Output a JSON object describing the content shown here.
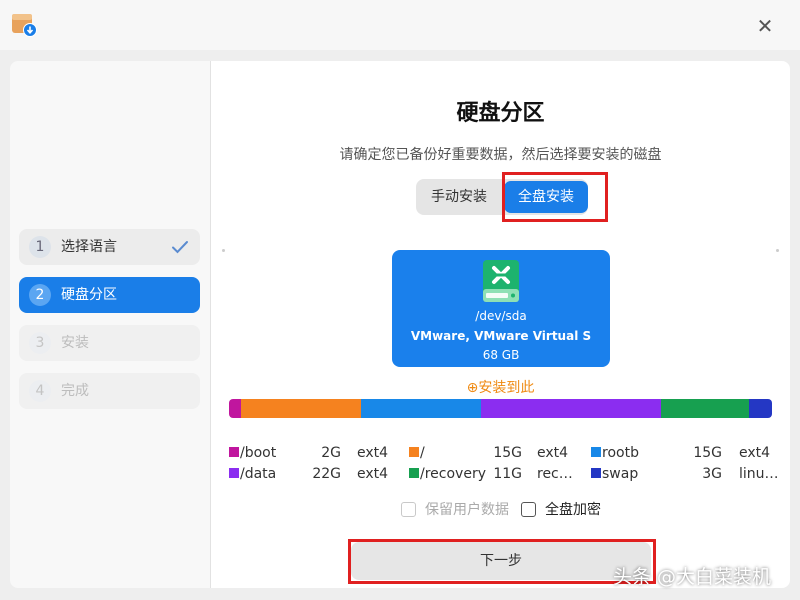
{
  "sidebar": {
    "steps": [
      {
        "num": "1",
        "label": "选择语言",
        "state": "done"
      },
      {
        "num": "2",
        "label": "硬盘分区",
        "state": "active"
      },
      {
        "num": "3",
        "label": "安装",
        "state": "disabled"
      },
      {
        "num": "4",
        "label": "完成",
        "state": "disabled"
      }
    ]
  },
  "main": {
    "title": "硬盘分区",
    "subtitle": "请确定您已备份好重要数据，然后选择要安装的磁盘",
    "mode": {
      "manual_label": "手动安装",
      "full_label": "全盘安装",
      "selected": "全盘安装"
    },
    "disk": {
      "device": "/dev/sda",
      "model": "VMware, VMware Virtual S",
      "size": "68 GB"
    },
    "install_here": "⊕安装到此",
    "partitions": [
      {
        "name": "/boot",
        "size": "2G",
        "fs": "ext4",
        "color": "#c0169e",
        "fraction": 0.022
      },
      {
        "name": "/",
        "size": "15G",
        "fs": "ext4",
        "color": "#f5821f",
        "fraction": 0.221
      },
      {
        "name": "rootb",
        "size": "15G",
        "fs": "ext4",
        "color": "#1888e8",
        "fraction": 0.221
      },
      {
        "name": "/data",
        "size": "22G",
        "fs": "ext4",
        "color": "#8b2df0",
        "fraction": 0.331
      },
      {
        "name": "/recovery",
        "size": "11G",
        "fs": "rec…",
        "color": "#17a050",
        "fraction": 0.162
      },
      {
        "name": "swap",
        "size": "3G",
        "fs": "linu…",
        "color": "#2437c4",
        "fraction": 0.043
      }
    ],
    "options": {
      "keep_user_data": "保留用户数据",
      "full_encrypt": "全盘加密"
    },
    "next_label": "下一步"
  },
  "watermark": "头条 @大白菜装机",
  "accent_color": "#1a7ee8",
  "highlight_color": "#e02020"
}
